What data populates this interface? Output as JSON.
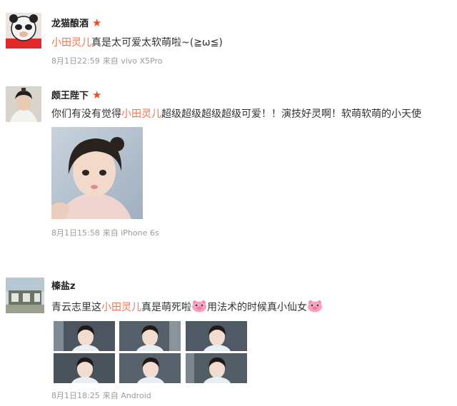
{
  "posts": [
    {
      "user": "龙猫酿酒",
      "verified_icon": "star-icon",
      "tag": "小田灵儿",
      "text": "真是太可爱太软萌啦~(≧ω≦)",
      "date": "8月1日22:59",
      "source_prefix": "来自",
      "source": "vivo X5Pro"
    },
    {
      "user": "颇王陛下",
      "verified_icon": "star-icon",
      "text_before": "你们有没有觉得",
      "tag": "小田灵儿",
      "text_after": "超级超级超级超级可爱！！演技好灵啊！软萌软萌的小天使",
      "date": "8月1日15:58",
      "source_prefix": "来自",
      "source": "iPhone 6s"
    },
    {
      "user": "榛盐z",
      "text_before": "青云志里这",
      "tag": "小田灵儿",
      "text_mid": "真是萌死啦",
      "text_after": "用法术的时候真小仙女",
      "emoji": "pink-pig-face-icon",
      "date": "8月1日18:25",
      "source_prefix": "来自",
      "source": "Android"
    }
  ],
  "colors": {
    "tag": "#eb7350",
    "verified_star": "#f04a24",
    "meta_text": "#9b9b9b",
    "emoji_pink": "#f7a3c0"
  }
}
